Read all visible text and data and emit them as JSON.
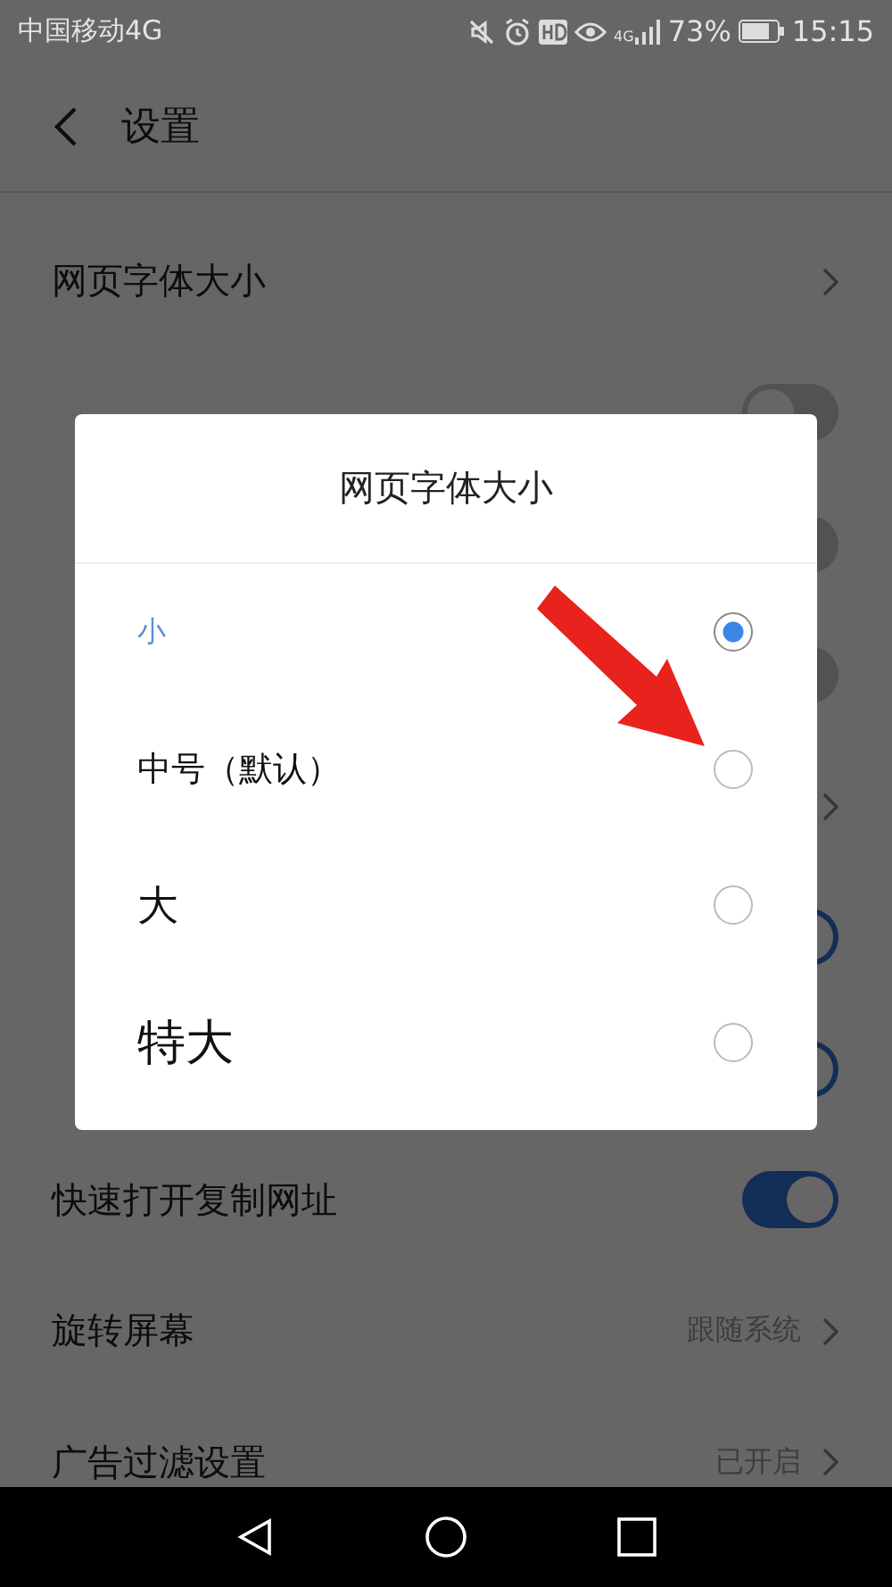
{
  "status_bar": {
    "carrier": "中国移动4G",
    "network": "4G",
    "battery": "73%",
    "time": "15:15"
  },
  "header": {
    "title": "设置"
  },
  "rows": [
    {
      "label": "网页字体大小",
      "kind": "link"
    },
    {
      "kind": "toggle",
      "on": false
    },
    {
      "kind": "toggle",
      "on": false
    },
    {
      "kind": "toggle",
      "on": false
    },
    {
      "kind": "link"
    },
    {
      "kind": "toggle",
      "on": true
    },
    {
      "kind": "toggle",
      "on": true
    },
    {
      "label": "快速打开复制网址",
      "kind": "toggle",
      "on": true
    },
    {
      "label": "旋转屏幕",
      "kind": "link",
      "value": "跟随系统"
    },
    {
      "label": "广告过滤设置",
      "kind": "link",
      "value": "已开启"
    }
  ],
  "dialog": {
    "title": "网页字体大小",
    "options": [
      {
        "label": "小",
        "selected": true
      },
      {
        "label": "中号（默认）",
        "selected": false
      },
      {
        "label": "大",
        "selected": false
      },
      {
        "label": "特大",
        "selected": false
      }
    ]
  }
}
